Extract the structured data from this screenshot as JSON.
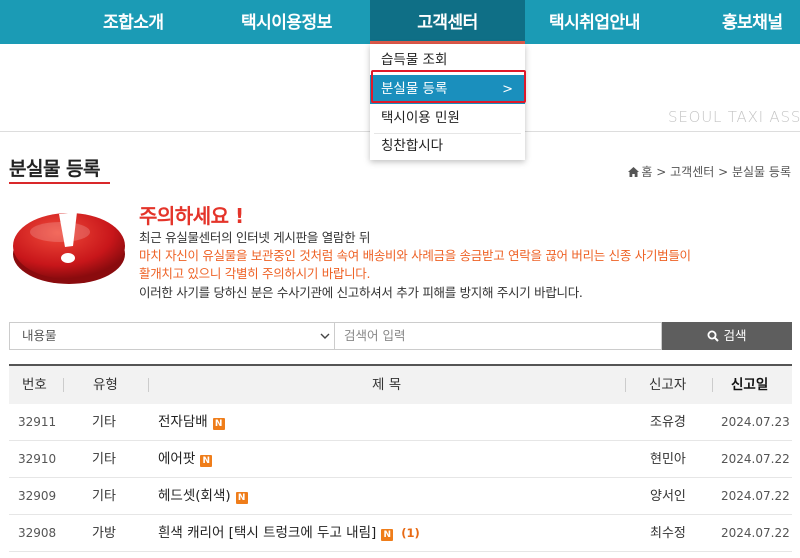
{
  "nav": {
    "items": [
      "조합소개",
      "택시이용정보",
      "고객센터",
      "택시취업안내",
      "홍보채널"
    ],
    "active_index": 2
  },
  "dropdown": {
    "items": [
      "습득물 조회",
      "분실물 등록",
      "택시이용 민원",
      "칭찬합시다"
    ],
    "selected_index": 1,
    "arrow": ">"
  },
  "brand_text": "SEOUL TAXI ASSO",
  "page": {
    "title": "분실물 등록",
    "breadcrumb": "홈 > 고객센터 > 분실물 등록"
  },
  "warning": {
    "title": "주의하세요 !",
    "line1": "최근 유실물센터의 인터넷 게시판을 열람한 뒤",
    "line2": "마치 자신이 유실물을 보관중인 것처럼 속여 배송비와 사례금을 송금받고 연락을 끊어 버리는 신종 사기범들이",
    "line3": "활개치고 있으니 각별히 주의하시기 바랍니다.",
    "line4": "이러한 사기를 당하신 분은 수사기관에 신고하셔서 추가 피해를 방지해 주시기 바랍니다."
  },
  "search": {
    "select_value": "내용물",
    "placeholder": "검색어 입력",
    "button_label": "검색"
  },
  "table": {
    "headers": {
      "num": "번호",
      "type": "유형",
      "title": "제 목",
      "author": "신고자",
      "date": "신고일"
    },
    "new_badge": "N",
    "rows": [
      {
        "num": "32911",
        "type": "기타",
        "title": "전자담배",
        "comments": "",
        "author": "조유경",
        "date": "2024.07.23"
      },
      {
        "num": "32910",
        "type": "기타",
        "title": "에어팟",
        "comments": "",
        "author": "현민아",
        "date": "2024.07.22"
      },
      {
        "num": "32909",
        "type": "기타",
        "title": "헤드셋(회색)",
        "comments": "",
        "author": "양서인",
        "date": "2024.07.22"
      },
      {
        "num": "32908",
        "type": "가방",
        "title": "흰색 캐리어 [택시 트렁크에 두고 내림]",
        "comments": "(1)",
        "author": "최수정",
        "date": "2024.07.22"
      }
    ]
  },
  "colors": {
    "nav_bg": "#1b9bb5",
    "nav_active": "#0f6f86",
    "dropdown_selected": "#1a8fbd",
    "highlight_border": "#e0192a",
    "warning_red": "#e4342a",
    "warning_orange": "#ee6226",
    "new_badge": "#ef7d1a"
  }
}
